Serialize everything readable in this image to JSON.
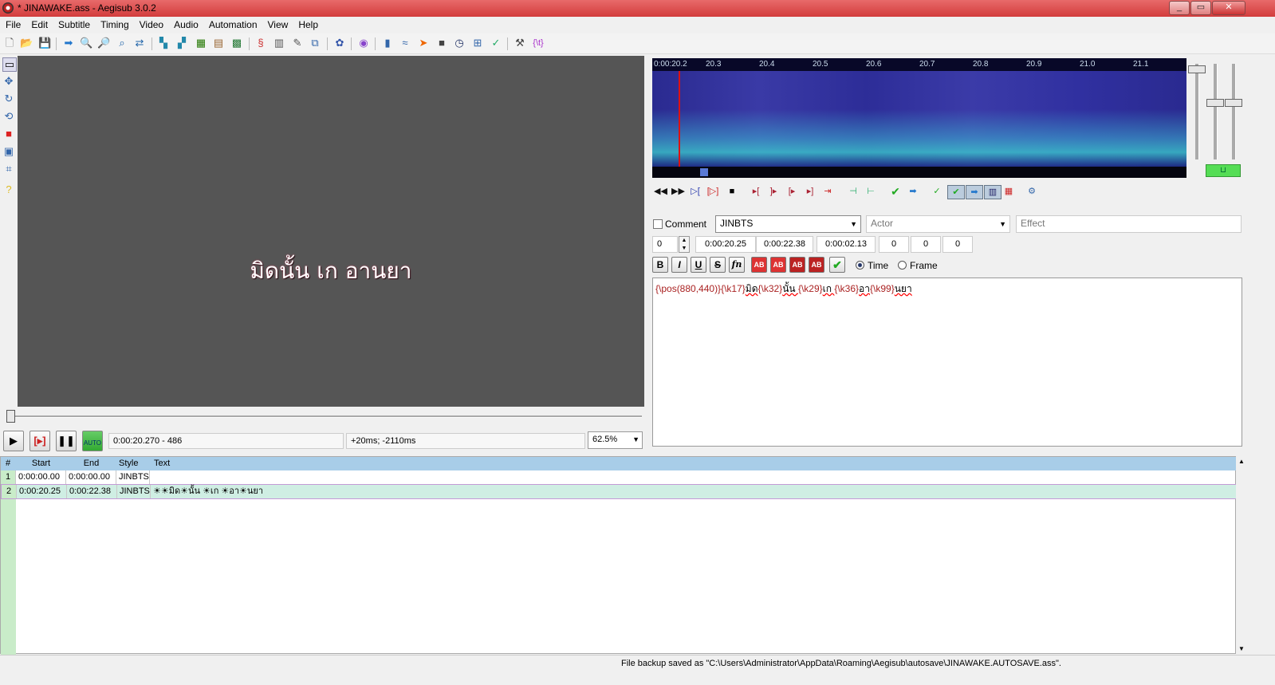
{
  "window": {
    "title": "* JINAWAKE.ass - Aegisub 3.0.2",
    "min": "_",
    "max": "▭",
    "close": "✕"
  },
  "menu": [
    "File",
    "Edit",
    "Subtitle",
    "Timing",
    "Video",
    "Audio",
    "Automation",
    "View",
    "Help"
  ],
  "video": {
    "subtitle_highlight": "มิด",
    "subtitle_rest": "นั้น เก อานยา",
    "time_info": "0:00:20.270 - 486",
    "offset_info": "+20ms; -2110ms",
    "zoom": "62.5%",
    "auto_label": "AUTO"
  },
  "audio": {
    "ticks": [
      "0:00:20.2",
      "20.3",
      "20.4",
      "20.5",
      "20.6",
      "20.7",
      "20.8",
      "20.9",
      "21.0",
      "21.1"
    ]
  },
  "editor": {
    "comment_label": "Comment",
    "style": "JINBTS",
    "actor_placeholder": "Actor",
    "effect_placeholder": "Effect",
    "layer": "0",
    "start": "0:00:20.25",
    "end": "0:00:22.38",
    "duration": "0:00:02.13",
    "margin_l": "0",
    "margin_r": "0",
    "margin_v": "0",
    "time_label": "Time",
    "frame_label": "Frame",
    "text_parts": {
      "p1": "{\\pos(880,440)}",
      "p2": "{\\k17}",
      "p3": "มิด",
      "p4": "{\\k32}",
      "p5": "นั้น ",
      "p6": "{\\k29}",
      "p7": "เก ",
      "p8": "{\\k36}",
      "p9": "อา",
      "p10": "{\\k99}",
      "p11": "นยา"
    }
  },
  "grid": {
    "headers": {
      "num": "#",
      "start": "Start",
      "end": "End",
      "style": "Style",
      "text": "Text"
    },
    "rows": [
      {
        "num": "1",
        "start": "0:00:00.00",
        "end": "0:00:00.00",
        "style": "JINBTS",
        "text": ""
      },
      {
        "num": "2",
        "start": "0:00:20.25",
        "end": "0:00:22.38",
        "style": "JINBTS",
        "text": "☀☀มิด☀นั้น ☀เก ☀อา☀นยา"
      }
    ]
  },
  "status": "File backup saved as \"C:\\Users\\Administrator\\AppData\\Roaming\\Aegisub\\autosave\\JINAWAKE.AUTOSAVE.ass\"."
}
